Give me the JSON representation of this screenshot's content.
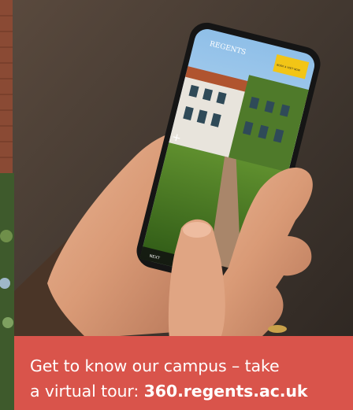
{
  "photo": {
    "phone_screen": {
      "logo_text": "REGENTS",
      "button_label": "BOOK A VISIT NOW",
      "bottom_label": "NEXT"
    }
  },
  "banner": {
    "line1": "Get to know our campus – take",
    "line2_prefix": "a virtual tour: ",
    "line2_link": "360.regents.ac.uk"
  },
  "colors": {
    "banner_bg": "#d9544b",
    "banner_text": "#ffffff",
    "phone_button": "#f2c516"
  }
}
